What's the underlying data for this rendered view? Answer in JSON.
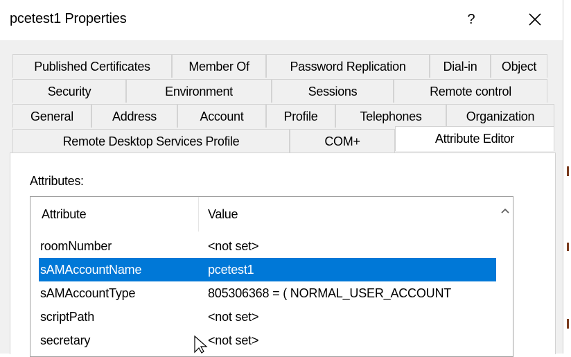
{
  "window": {
    "title": "pcetest1 Properties",
    "help_label": "?",
    "close_label": "✕"
  },
  "tabs": {
    "row1": [
      "Published Certificates",
      "Member Of",
      "Password Replication",
      "Dial-in",
      "Object"
    ],
    "row2": [
      "Security",
      "Environment",
      "Sessions",
      "Remote control"
    ],
    "row3": [
      "General",
      "Address",
      "Account",
      "Profile",
      "Telephones",
      "Organization"
    ],
    "row4": [
      "Remote Desktop Services Profile",
      "COM+",
      "Attribute Editor"
    ],
    "active": "Attribute Editor"
  },
  "attributes": {
    "label": "Attributes:",
    "columns": [
      "Attribute",
      "Value"
    ],
    "rows": [
      {
        "attribute": "roomNumber",
        "value": "<not set>"
      },
      {
        "attribute": "sAMAccountName",
        "value": "pcetest1",
        "selected": true
      },
      {
        "attribute": "sAMAccountType",
        "value": "805306368 = ( NORMAL_USER_ACCOUNT"
      },
      {
        "attribute": "scriptPath",
        "value": "<not set>"
      },
      {
        "attribute": "secretary",
        "value": "<not set>"
      }
    ]
  },
  "colors": {
    "selection": "#0078d7",
    "dialog_bg": "#f0f0f0"
  }
}
